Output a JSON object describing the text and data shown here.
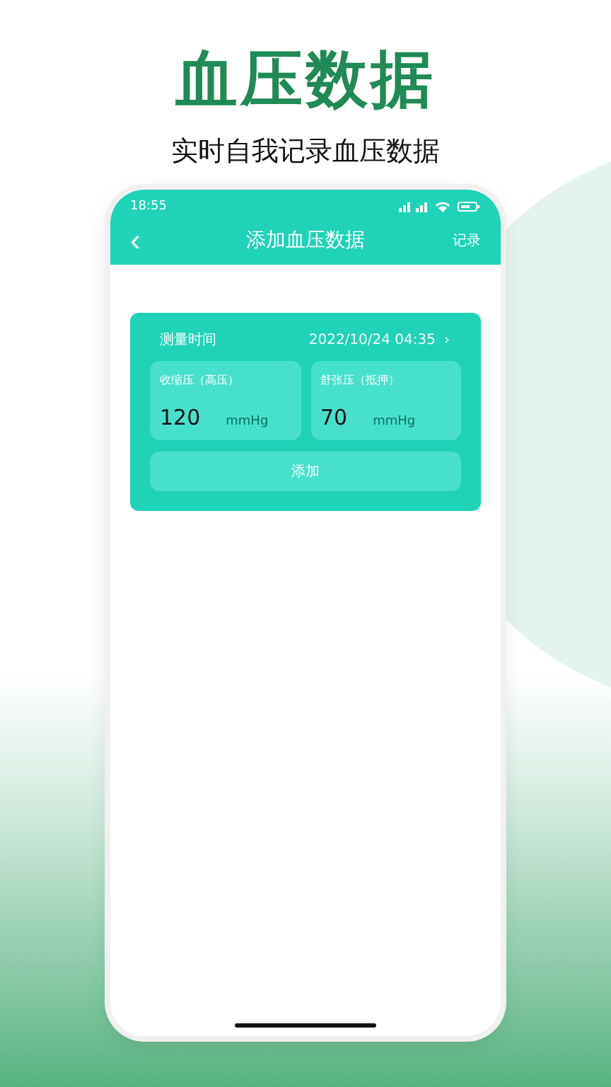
{
  "headline": "血压数据",
  "subtitle": "实时自我记录血压数据",
  "status_bar": {
    "time": "18:55"
  },
  "nav_bar": {
    "back": "‹",
    "title": "添加血压数据",
    "action": "记录"
  },
  "form": {
    "time_label": "测量时间",
    "time_value": "2022/10/24 04:35",
    "time_chevron": "›",
    "fields": [
      {
        "label": "收缩压（高压）",
        "value": "120",
        "unit": "mmHg"
      },
      {
        "label": "舒张压（抵押）",
        "value": "70",
        "unit": "mmHg"
      }
    ],
    "button": "添加"
  }
}
